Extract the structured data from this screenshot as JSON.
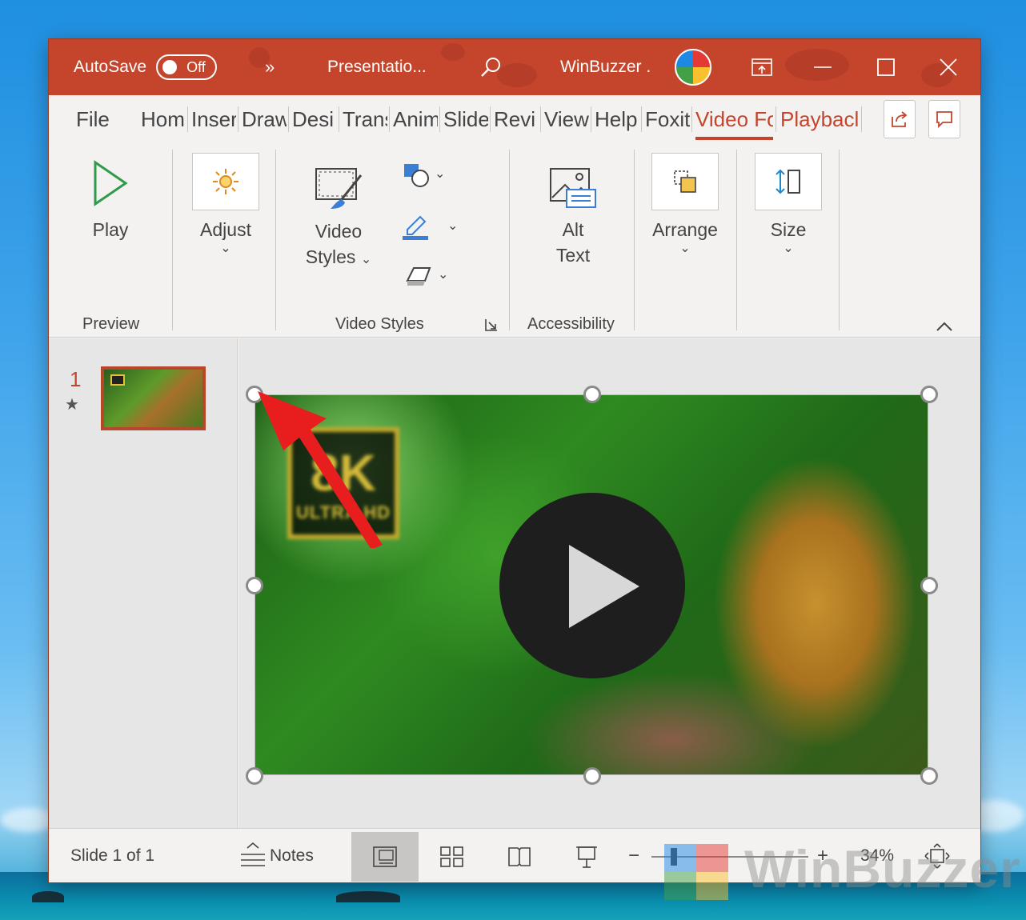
{
  "titlebar": {
    "autosave_label": "AutoSave",
    "autosave_state": "Off",
    "more_glyph": "»",
    "doc_title": "Presentatio...",
    "user_name": "WinBuzzer ."
  },
  "tabs": [
    {
      "label": "File"
    },
    {
      "label": "Hom"
    },
    {
      "label": "Inser"
    },
    {
      "label": "Draw"
    },
    {
      "label": "Desi"
    },
    {
      "label": "Trans"
    },
    {
      "label": "Anim"
    },
    {
      "label": "Slide"
    },
    {
      "label": "Revi"
    },
    {
      "label": "View"
    },
    {
      "label": "Help"
    },
    {
      "label": "Foxit"
    },
    {
      "label": "Video Fo"
    },
    {
      "label": "Playbacl"
    }
  ],
  "ribbon": {
    "play_label": "Play",
    "adjust_label": "Adjust",
    "video_styles_line1": "Video",
    "video_styles_line2": "Styles",
    "alt_text_line1": "Alt",
    "alt_text_line2": "Text",
    "arrange_label": "Arrange",
    "size_label": "Size",
    "group_preview": "Preview",
    "group_video_styles": "Video Styles",
    "group_accessibility": "Accessibility"
  },
  "slides": {
    "number": "1"
  },
  "video": {
    "badge_main": "8K",
    "badge_sub": "ULTRA HD"
  },
  "status": {
    "slide_info": "Slide 1 of 1",
    "notes_label": "Notes",
    "zoom_minus": "−",
    "zoom_plus": "+",
    "zoom_level": "34%"
  },
  "watermark": {
    "text": "WinBuzzer"
  },
  "colors": {
    "accent": "#c4452c",
    "ribbon_bg": "#f3f2f1",
    "arrow": "#e81e1e"
  }
}
